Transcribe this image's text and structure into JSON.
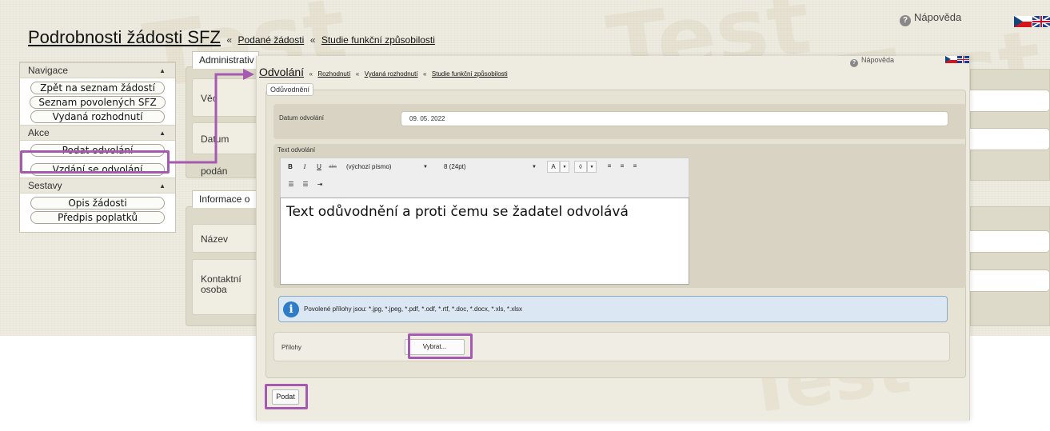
{
  "background": {
    "title": "Podrobnosti žádosti SFZ",
    "sep": "«",
    "breadcrumb": [
      "Podané žádosti",
      "Studie funkční způsobilosti"
    ],
    "help": "Nápověda",
    "watermark": "Test",
    "sidebar": {
      "sections": [
        {
          "label": "Navigace",
          "items": [
            "Zpět na seznam žádostí",
            "Seznam povolených SFZ",
            "Vydaná rozhodnutí"
          ]
        },
        {
          "label": "Akce",
          "items": [
            "Podat odvolání",
            "Vzdání se odvolání"
          ]
        },
        {
          "label": "Sestavy",
          "items": [
            "Opis žádosti",
            "Předpis poplatků"
          ]
        }
      ]
    },
    "tabs": [
      "Administrativ",
      "Informace o"
    ],
    "fields": [
      "Věc",
      "Datum podán",
      "Název",
      "Kontaktní osoba"
    ]
  },
  "dialog": {
    "title": "Odvolání",
    "sep": "«",
    "breadcrumb": [
      "Rozhodnutí",
      "Vydaná rozhodnutí",
      "Studie funkční způsobilosti"
    ],
    "help": "Nápověda",
    "legend": "Odůvodnění",
    "date_label": "Datum odvolání",
    "date_value": "09. 05. 2022",
    "text_label": "Text odvolání",
    "toolbar": {
      "bold": "B",
      "italic": "I",
      "underline": "U",
      "strike": "abc",
      "font": "(výchozí písmo)",
      "size": "8 (24pt)",
      "font_color": "A",
      "highlight": "◊"
    },
    "editor_text": "Text odůvodnění a proti čemu se žadatel odvolává",
    "info_text": "Povolené přílohy jsou: *.jpg, *.jpeg, *.pdf, *.odf, *.rtf, *.doc, *.docx, *.xls, *.xlsx",
    "attachments_label": "Přílohy",
    "choose_button": "Vybrat...",
    "submit_button": "Podat"
  },
  "colors": {
    "highlight": "#a559b0",
    "panel": "#dedac9",
    "info": "#dbe8f3"
  }
}
